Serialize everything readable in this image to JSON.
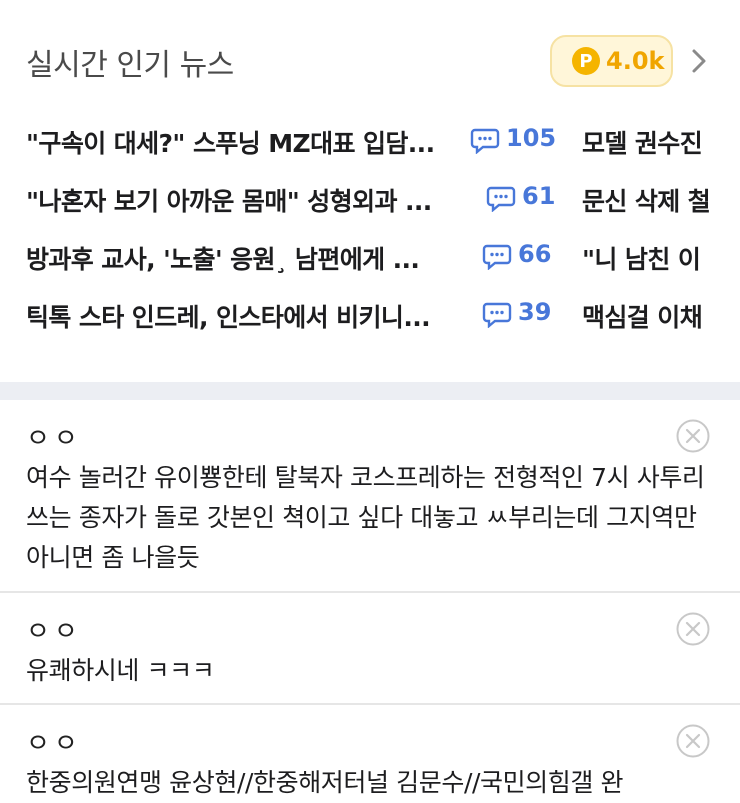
{
  "header": {
    "title": "실시간 인기 뉴스",
    "points": {
      "coin_label": "P",
      "value": "4.0k",
      "color": "#f5b400"
    }
  },
  "news": [
    {
      "title": "\"구속이 대세?\" 스푸닝 MZ대표 입담...",
      "comments": "105",
      "title2": "모델 권수진"
    },
    {
      "title": "\"나혼자 보기 아까운 몸매\" 성형외과 ...",
      "comments": "61",
      "title2": "문신 삭제 철"
    },
    {
      "title": "방과후 교사, '노출' 응원¸ 남편에게 ...",
      "comments": "66",
      "title2": "\"니 남친 이"
    },
    {
      "title": "틱톡 스타 인드레, 인스타에서 비키니...",
      "comments": "39",
      "title2": "맥심걸 이채"
    }
  ],
  "comments": [
    {
      "author": "ㅇㅇ",
      "text": "여수 놀러간 유이뿅한테 탈북자 코스프레하는 전형적인 7시 사투리쓰는 종자가 돌로 갓본인 쳑이고 싶다 대놓고 ㅆ부리는데 그지역만 아니면 좀 나을듯"
    },
    {
      "author": "ㅇㅇ",
      "text": "유쾌하시네 ㅋㅋㅋ"
    },
    {
      "author": "ㅇㅇ",
      "text": "한중의원연맹 윤상현//한중해저터널 김문수//국민의힘갤 완"
    }
  ],
  "colors": {
    "comment_count": "#4877d9",
    "divider": "#eceef3"
  }
}
